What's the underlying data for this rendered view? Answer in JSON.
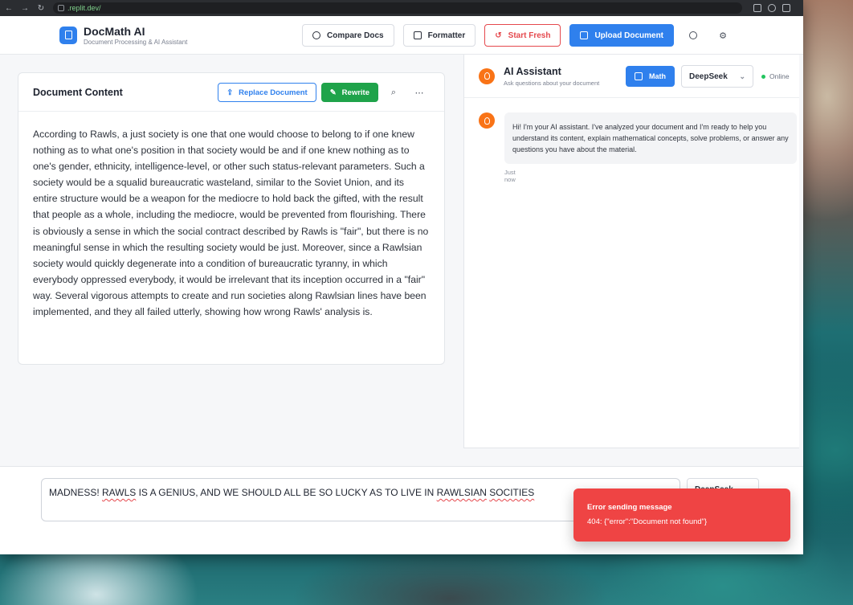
{
  "browser": {
    "url": ".replit.dev/"
  },
  "header": {
    "brand_title": "DocMath AI",
    "brand_subtitle": "Document Processing & AI Assistant",
    "compare_label": "Compare Docs",
    "formatter_label": "Formatter",
    "start_fresh_label": "Start Fresh",
    "upload_label": "Upload Document"
  },
  "document": {
    "title": "Document Content",
    "replace_label": "Replace Document",
    "rewrite_label": "Rewrite",
    "content": "According to Rawls, a just society is one that one would choose to belong to if one knew nothing as to what one's position in that society would be and if one knew nothing as to one's gender, ethnicity, intelligence-level, or other such status-relevant parameters. Such a society would be a squalid bureaucratic wasteland, similar to the Soviet Union, and its entire structure would be a weapon for the mediocre to hold back the gifted, with the result that people as a whole, including the mediocre, would be prevented from flourishing. There is obviously a sense in which the social contract described by Rawls is \"fair\", but there is no meaningful sense in which the resulting society would be just. Moreover, since a Rawlsian society would quickly degenerate into a condition of bureaucratic tyranny, in which everybody oppressed everybody, it would be irrelevant that its inception occurred in a \"fair\" way. Several vigorous attempts to create and run societies along Rawlsian lines have been implemented, and they all failed utterly, showing how wrong Rawls' analysis is."
  },
  "assistant": {
    "title": "AI Assistant",
    "subtitle": "Ask questions about your document",
    "math_label": "Math",
    "model": "DeepSeek",
    "status": "Online",
    "messages": [
      {
        "text": "Hi! I'm your AI assistant. I've analyzed your document and I'm ready to help you understand its content, explain mathematical concepts, solve problems, or answer any questions you have about the material.",
        "time": "Just now"
      }
    ]
  },
  "composer": {
    "value_parts": [
      "MADNESS! ",
      "RAWLS",
      " IS A GENIUS, AND WE SHOULD ALL BE SO LUCKY AS TO LIVE IN ",
      "RAWLSIAN",
      " ",
      "SOCITIES"
    ],
    "model": "DeepSeek"
  },
  "toast": {
    "title": "Error sending message",
    "message": "404: {\"error\":\"Document not found\"}"
  },
  "colors": {
    "primary": "#2f80ed",
    "success": "#1fa34a",
    "danger": "#ef4444",
    "accent": "#f97316"
  }
}
